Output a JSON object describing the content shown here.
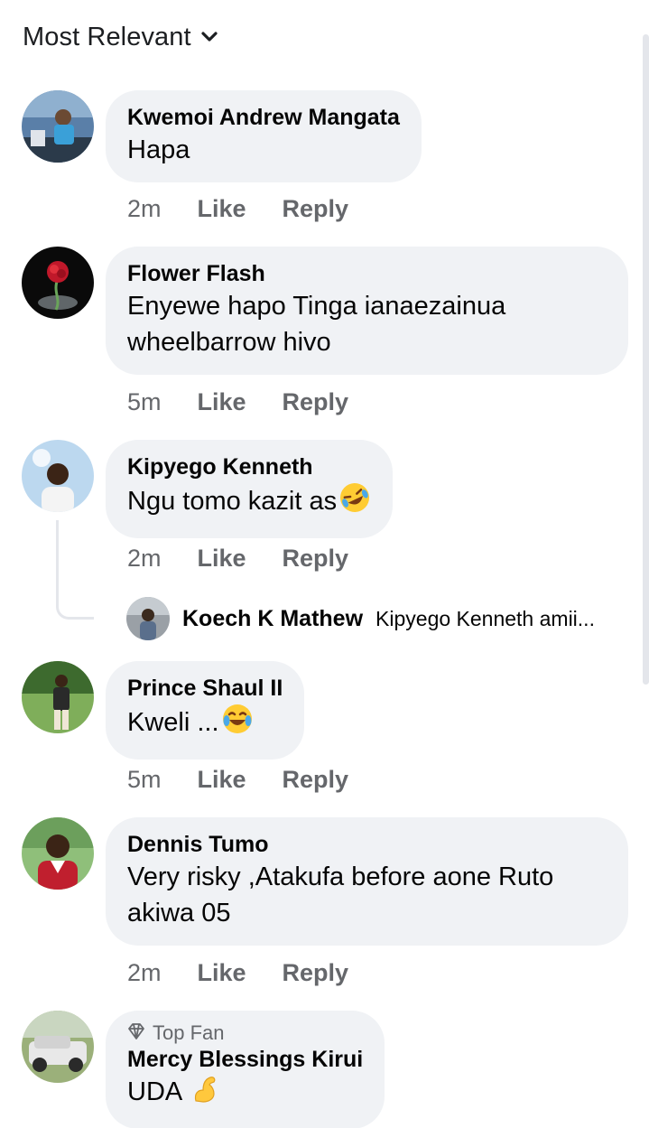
{
  "sort": {
    "label": "Most Relevant",
    "icon": "chevron-down-icon"
  },
  "actions": {
    "like": "Like",
    "reply": "Reply"
  },
  "comments": [
    {
      "author": "Kwemoi Andrew Mangata",
      "text": "Hapa",
      "time": "2m"
    },
    {
      "author": "Flower Flash",
      "text_lines": [
        "Enyewe hapo Tinga ianaezainua",
        "wheelbarrow hivo"
      ],
      "time": "5m"
    },
    {
      "author": "Kipyego Kenneth",
      "text": "Ngu tomo kazit as",
      "emoji": "rolling-on-floor-laughing",
      "time": "2m",
      "reply": {
        "author": "Koech K Mathew",
        "preview": "Kipyego Kenneth amii..."
      }
    },
    {
      "author": "Prince Shaul II",
      "text": "Kweli ...",
      "emoji": "tears-of-joy",
      "time": "5m"
    },
    {
      "author": "Dennis Tumo",
      "text_lines": [
        "Very risky ,Atakufa before aone Ruto",
        "akiwa 05"
      ],
      "time": "2m"
    },
    {
      "badge": "Top Fan",
      "badge_icon": "diamond-icon",
      "author": "Mercy Blessings Kirui",
      "text": "UDA",
      "emoji": "flexed-biceps"
    }
  ],
  "colors": {
    "bubble": "#f0f2f5",
    "meta": "#65676b",
    "text": "#050505"
  }
}
